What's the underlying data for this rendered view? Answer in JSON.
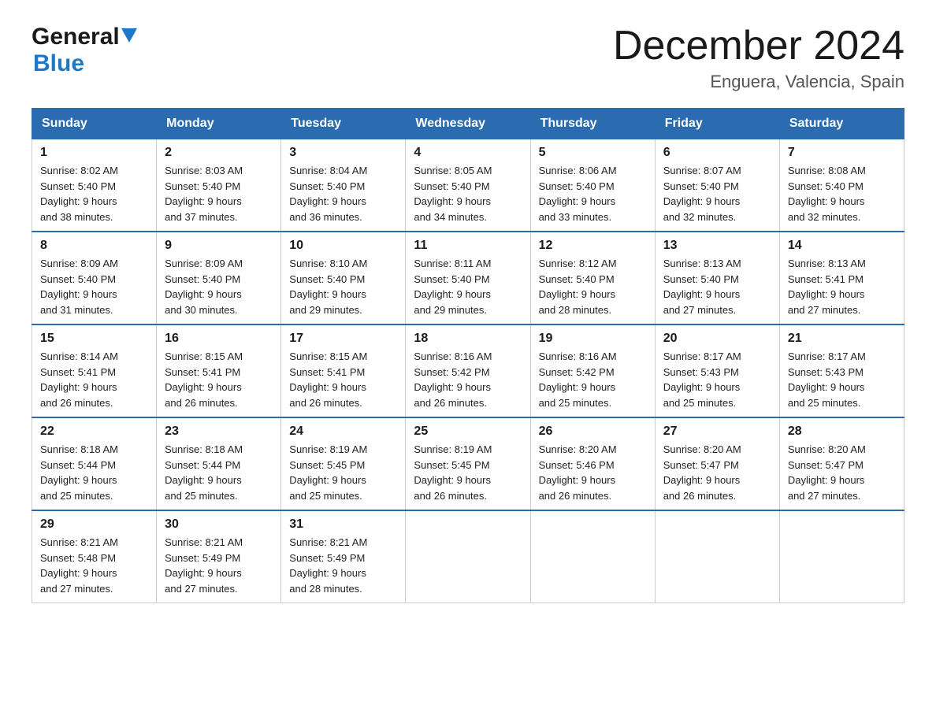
{
  "header": {
    "logo_general": "General",
    "logo_blue": "Blue",
    "month_title": "December 2024",
    "location": "Enguera, Valencia, Spain"
  },
  "columns": [
    "Sunday",
    "Monday",
    "Tuesday",
    "Wednesday",
    "Thursday",
    "Friday",
    "Saturday"
  ],
  "weeks": [
    [
      {
        "day": "1",
        "sunrise": "8:02 AM",
        "sunset": "5:40 PM",
        "daylight": "9 hours and 38 minutes."
      },
      {
        "day": "2",
        "sunrise": "8:03 AM",
        "sunset": "5:40 PM",
        "daylight": "9 hours and 37 minutes."
      },
      {
        "day": "3",
        "sunrise": "8:04 AM",
        "sunset": "5:40 PM",
        "daylight": "9 hours and 36 minutes."
      },
      {
        "day": "4",
        "sunrise": "8:05 AM",
        "sunset": "5:40 PM",
        "daylight": "9 hours and 34 minutes."
      },
      {
        "day": "5",
        "sunrise": "8:06 AM",
        "sunset": "5:40 PM",
        "daylight": "9 hours and 33 minutes."
      },
      {
        "day": "6",
        "sunrise": "8:07 AM",
        "sunset": "5:40 PM",
        "daylight": "9 hours and 32 minutes."
      },
      {
        "day": "7",
        "sunrise": "8:08 AM",
        "sunset": "5:40 PM",
        "daylight": "9 hours and 32 minutes."
      }
    ],
    [
      {
        "day": "8",
        "sunrise": "8:09 AM",
        "sunset": "5:40 PM",
        "daylight": "9 hours and 31 minutes."
      },
      {
        "day": "9",
        "sunrise": "8:09 AM",
        "sunset": "5:40 PM",
        "daylight": "9 hours and 30 minutes."
      },
      {
        "day": "10",
        "sunrise": "8:10 AM",
        "sunset": "5:40 PM",
        "daylight": "9 hours and 29 minutes."
      },
      {
        "day": "11",
        "sunrise": "8:11 AM",
        "sunset": "5:40 PM",
        "daylight": "9 hours and 29 minutes."
      },
      {
        "day": "12",
        "sunrise": "8:12 AM",
        "sunset": "5:40 PM",
        "daylight": "9 hours and 28 minutes."
      },
      {
        "day": "13",
        "sunrise": "8:13 AM",
        "sunset": "5:40 PM",
        "daylight": "9 hours and 27 minutes."
      },
      {
        "day": "14",
        "sunrise": "8:13 AM",
        "sunset": "5:41 PM",
        "daylight": "9 hours and 27 minutes."
      }
    ],
    [
      {
        "day": "15",
        "sunrise": "8:14 AM",
        "sunset": "5:41 PM",
        "daylight": "9 hours and 26 minutes."
      },
      {
        "day": "16",
        "sunrise": "8:15 AM",
        "sunset": "5:41 PM",
        "daylight": "9 hours and 26 minutes."
      },
      {
        "day": "17",
        "sunrise": "8:15 AM",
        "sunset": "5:41 PM",
        "daylight": "9 hours and 26 minutes."
      },
      {
        "day": "18",
        "sunrise": "8:16 AM",
        "sunset": "5:42 PM",
        "daylight": "9 hours and 26 minutes."
      },
      {
        "day": "19",
        "sunrise": "8:16 AM",
        "sunset": "5:42 PM",
        "daylight": "9 hours and 25 minutes."
      },
      {
        "day": "20",
        "sunrise": "8:17 AM",
        "sunset": "5:43 PM",
        "daylight": "9 hours and 25 minutes."
      },
      {
        "day": "21",
        "sunrise": "8:17 AM",
        "sunset": "5:43 PM",
        "daylight": "9 hours and 25 minutes."
      }
    ],
    [
      {
        "day": "22",
        "sunrise": "8:18 AM",
        "sunset": "5:44 PM",
        "daylight": "9 hours and 25 minutes."
      },
      {
        "day": "23",
        "sunrise": "8:18 AM",
        "sunset": "5:44 PM",
        "daylight": "9 hours and 25 minutes."
      },
      {
        "day": "24",
        "sunrise": "8:19 AM",
        "sunset": "5:45 PM",
        "daylight": "9 hours and 25 minutes."
      },
      {
        "day": "25",
        "sunrise": "8:19 AM",
        "sunset": "5:45 PM",
        "daylight": "9 hours and 26 minutes."
      },
      {
        "day": "26",
        "sunrise": "8:20 AM",
        "sunset": "5:46 PM",
        "daylight": "9 hours and 26 minutes."
      },
      {
        "day": "27",
        "sunrise": "8:20 AM",
        "sunset": "5:47 PM",
        "daylight": "9 hours and 26 minutes."
      },
      {
        "day": "28",
        "sunrise": "8:20 AM",
        "sunset": "5:47 PM",
        "daylight": "9 hours and 27 minutes."
      }
    ],
    [
      {
        "day": "29",
        "sunrise": "8:21 AM",
        "sunset": "5:48 PM",
        "daylight": "9 hours and 27 minutes."
      },
      {
        "day": "30",
        "sunrise": "8:21 AM",
        "sunset": "5:49 PM",
        "daylight": "9 hours and 27 minutes."
      },
      {
        "day": "31",
        "sunrise": "8:21 AM",
        "sunset": "5:49 PM",
        "daylight": "9 hours and 28 minutes."
      },
      null,
      null,
      null,
      null
    ]
  ]
}
